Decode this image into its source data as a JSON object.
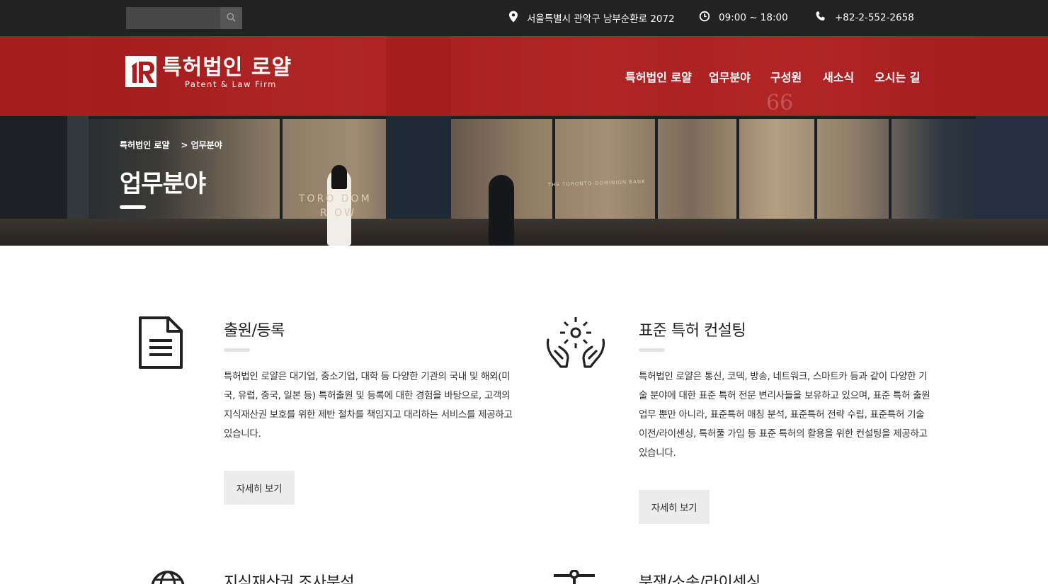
{
  "topbar": {
    "search": {
      "placeholder": "",
      "value": ""
    },
    "address": "서울특별시 관악구 남부순환로 2072",
    "hours": "09:00 ~ 18:00",
    "phone": "+82-2-552-2658"
  },
  "logo": {
    "name": "특허법인 로얄",
    "subtitle": "Patent & Law Firm"
  },
  "nav": {
    "items": [
      "특허법인 로얄",
      "업무분야",
      "구성원",
      "새소식",
      "오시는 길"
    ]
  },
  "hero": {
    "quote_mark": "66",
    "breadcrumb": {
      "home": "특허법인 로얄",
      "current": "> 업무분야"
    },
    "title": "업무분야",
    "signs": {
      "left": "TORO    DOM",
      "left2": "R      OW",
      "bank": "THE TORONTO-DOMINION BANK"
    }
  },
  "services": [
    {
      "title": "출원/등록",
      "icon": "document-icon",
      "description": "특허법인 로얄은 대기업, 중소기업, 대학 등 다양한 기관의 국내 및 해외(미국, 유럽, 중국, 일본 등) 특허출원 및 등록에 대한 경험을 바탕으로, 고객의 지식재산권 보호를 위한 제반 절차를 책임지고 대리하는 서비스를 제공하고 있습니다.",
      "button": "자세히 보기"
    },
    {
      "title": "표준 특허 컨설팅",
      "icon": "hands-idea-icon",
      "description": "특허법인 로얄은 통신, 코덱, 방송, 네트워크, 스마트카 등과 같이 다양한 기술 분야에 대한 표준 특허 전문 변리사들을 보유하고 있으며, 표준 특허 출원 업무 뿐만 아니라, 표준특허 매칭 분석, 표준특허 전략 수립, 표준특허 기술이전/라이센싱, 특허풀 가입 등 표준 특허의 활용을 위한 컨설팅을 제공하고 있습니다.",
      "button": "자세히 보기"
    },
    {
      "title": "지식재산권 조사분석",
      "icon": "globe-icon"
    },
    {
      "title": "분쟁/소송/라이센싱",
      "icon": "scales-icon"
    }
  ]
}
